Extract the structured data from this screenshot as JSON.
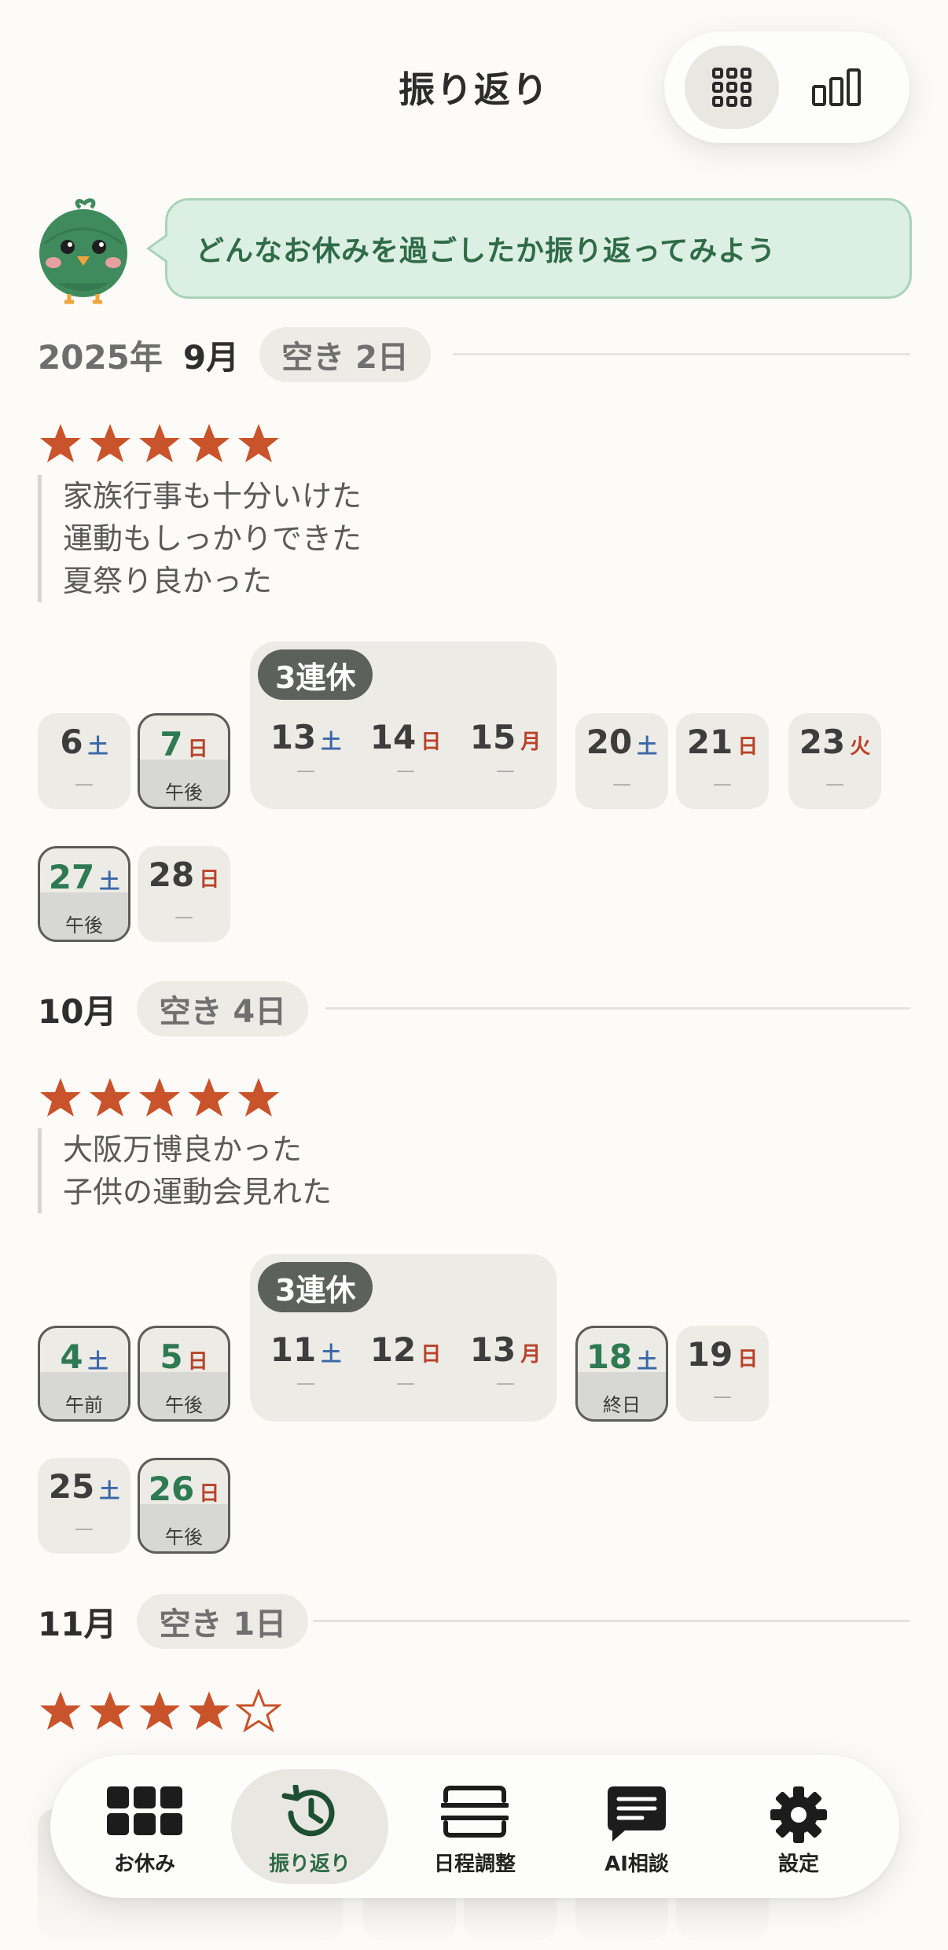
{
  "header": {
    "title": "振り返り"
  },
  "view_toggle": {
    "grid_icon": "grid-icon",
    "bars_icon": "bar-chart-icon"
  },
  "mascot": {
    "icon": "green-bird-mascot"
  },
  "bubble": {
    "text": "どんなお休みを過ごしたか振り返ってみよう"
  },
  "months": [
    {
      "year": "2025年",
      "month": "9月",
      "free": "空き 2日",
      "rating": 5,
      "note": [
        "家族行事も十分いけた",
        "運動もしっかりできた",
        "夏祭り良かった"
      ],
      "group_label": "3連休",
      "days": [
        {
          "day": "6",
          "wd": "土",
          "sub": "—"
        },
        {
          "day": "7",
          "wd": "日",
          "sub": "午後"
        },
        {
          "day": "13",
          "wd": "土",
          "sub": "—"
        },
        {
          "day": "14",
          "wd": "日",
          "sub": "—"
        },
        {
          "day": "15",
          "wd": "月",
          "sub": "—"
        },
        {
          "day": "20",
          "wd": "土",
          "sub": "—"
        },
        {
          "day": "21",
          "wd": "日",
          "sub": "—"
        },
        {
          "day": "23",
          "wd": "火",
          "sub": "—"
        },
        {
          "day": "27",
          "wd": "土",
          "sub": "午後"
        },
        {
          "day": "28",
          "wd": "日",
          "sub": "—"
        }
      ]
    },
    {
      "month": "10月",
      "free": "空き 4日",
      "rating": 5,
      "note": [
        "大阪万博良かった",
        "子供の運動会見れた"
      ],
      "group_label": "3連休",
      "days": [
        {
          "day": "4",
          "wd": "土",
          "sub": "午前"
        },
        {
          "day": "5",
          "wd": "日",
          "sub": "午後"
        },
        {
          "day": "11",
          "wd": "土",
          "sub": "—"
        },
        {
          "day": "12",
          "wd": "日",
          "sub": "—"
        },
        {
          "day": "13",
          "wd": "月",
          "sub": "—"
        },
        {
          "day": "18",
          "wd": "土",
          "sub": "終日"
        },
        {
          "day": "19",
          "wd": "日",
          "sub": "—"
        },
        {
          "day": "25",
          "wd": "土",
          "sub": "—"
        },
        {
          "day": "26",
          "wd": "日",
          "sub": "午後"
        }
      ]
    },
    {
      "month": "11月",
      "free": "空き 1日",
      "rating": 4
    }
  ],
  "nav": {
    "items": [
      {
        "label": "お休み",
        "icon": "grid-icon"
      },
      {
        "label": "振り返り",
        "icon": "history-icon"
      },
      {
        "label": "日程調整",
        "icon": "schedule-icon"
      },
      {
        "label": "AI相談",
        "icon": "chat-icon"
      },
      {
        "label": "設定",
        "icon": "gear-icon"
      }
    ],
    "active": "振り返り"
  },
  "colors": {
    "star": "#c9532a",
    "accent_green": "#2e7a52",
    "saturday": "#3b67a8",
    "sunday": "#b8432a"
  }
}
